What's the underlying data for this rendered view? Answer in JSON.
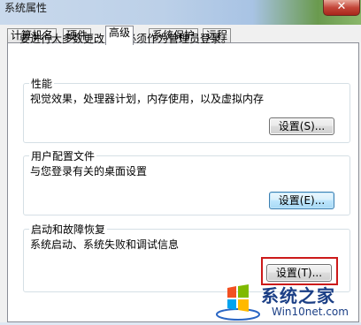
{
  "window": {
    "title": "系统属性",
    "close_glyph": "✕"
  },
  "tabs": [
    {
      "label": "计算机名"
    },
    {
      "label": "硬件"
    },
    {
      "label": "高级",
      "active": true
    },
    {
      "label": "系统保护"
    },
    {
      "label": "远程"
    }
  ],
  "advanced": {
    "admin_notice": "要进行大多数更改，您必须作为管理员登录。",
    "performance": {
      "title": "性能",
      "description": "视觉效果，处理器计划，内存使用，以及虚拟内存",
      "button": "设置(S)..."
    },
    "user_profiles": {
      "title": "用户配置文件",
      "description": "与您登录有关的桌面设置",
      "button": "设置(E)..."
    },
    "startup_recovery": {
      "title": "启动和故障恢复",
      "description": "系统启动、系统失败和调试信息",
      "button": "设置(T)..."
    }
  },
  "watermark": {
    "brand": "系统之家",
    "url": "Win10net.com",
    "logo_icon": "windows-logo-icon"
  },
  "colors": {
    "highlight": "#cc1a1a",
    "watermark": "#1b3f86"
  }
}
